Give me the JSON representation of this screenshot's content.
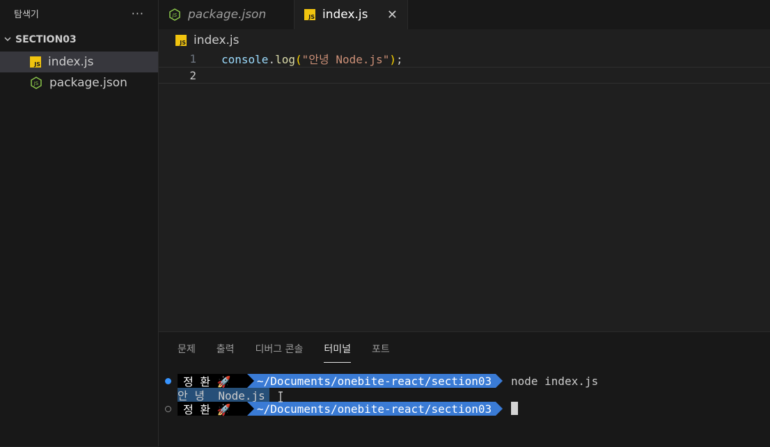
{
  "sidebar": {
    "title": "탐색기",
    "more": "···",
    "section": "SECTION03",
    "files": [
      {
        "name": "index.js",
        "icon": "js-file-icon"
      },
      {
        "name": "package.json",
        "icon": "nodejs-file-icon"
      }
    ]
  },
  "tabs": [
    {
      "label": "package.json",
      "icon": "nodejs-file-icon",
      "active": false
    },
    {
      "label": "index.js",
      "icon": "js-file-icon",
      "active": true,
      "close": "✕"
    }
  ],
  "breadcrumb": {
    "file": "index.js"
  },
  "editor": {
    "lines": [
      {
        "num": "1",
        "tokens": {
          "obj": "console",
          "dot": ".",
          "fn": "log",
          "open": "(",
          "str": "\"안녕 Node.js\"",
          "close": ")",
          "semi": ";"
        }
      },
      {
        "num": "2"
      }
    ],
    "current_line": 2
  },
  "panel": {
    "tabs": [
      "문제",
      "출력",
      "디버그 콘솔",
      "터미널",
      "포트"
    ],
    "active_tab": "터미널"
  },
  "terminal": {
    "user": "정 환 🚀",
    "path": "~/Documents/onebite-react/section03",
    "command": "node index.js",
    "output": "안 녕  Node.js"
  },
  "colors": {
    "accent": "#3794ff",
    "path_segment": "#3a7bd5",
    "js_icon": "#f1c40f",
    "node_icon": "#8cc84b"
  }
}
